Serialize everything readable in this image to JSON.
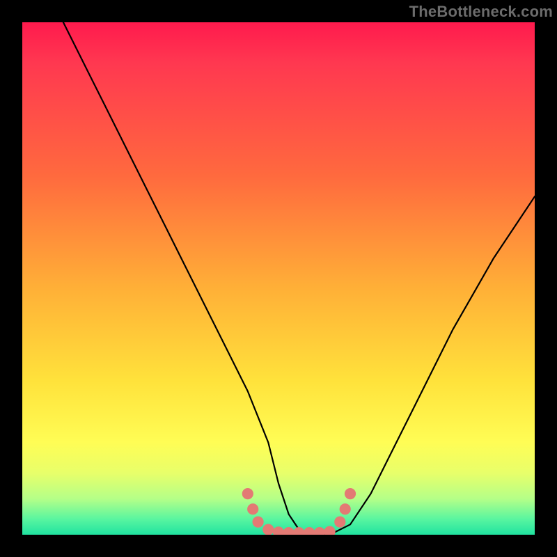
{
  "watermark": {
    "text": "TheBottleneck.com"
  },
  "chart_data": {
    "type": "line",
    "title": "",
    "xlabel": "",
    "ylabel": "",
    "xlim": [
      0,
      100
    ],
    "ylim": [
      0,
      100
    ],
    "grid": false,
    "legend": false,
    "background": {
      "kind": "vertical-gradient",
      "stops": [
        {
          "pos": 0,
          "color": "#ff1a4d"
        },
        {
          "pos": 50,
          "color": "#ffb037"
        },
        {
          "pos": 82,
          "color": "#fffd55"
        },
        {
          "pos": 100,
          "color": "#20e3a0"
        }
      ]
    },
    "series": [
      {
        "name": "bottleneck-curve",
        "color": "#000000",
        "x": [
          8,
          12,
          16,
          20,
          24,
          28,
          32,
          36,
          40,
          44,
          48,
          50,
          52,
          54,
          56,
          58,
          60,
          64,
          68,
          72,
          76,
          80,
          84,
          88,
          92,
          96,
          100
        ],
        "y": [
          100,
          92,
          84,
          76,
          68,
          60,
          52,
          44,
          36,
          28,
          18,
          10,
          4,
          1,
          0,
          0,
          0,
          2,
          8,
          16,
          24,
          32,
          40,
          47,
          54,
          60,
          66
        ]
      }
    ],
    "markers": [
      {
        "name": "floor-point",
        "x": 44,
        "y": 8,
        "color": "#e37a74",
        "r": 1.1
      },
      {
        "name": "floor-point",
        "x": 45,
        "y": 5,
        "color": "#e37a74",
        "r": 1.1
      },
      {
        "name": "floor-point",
        "x": 46,
        "y": 2.5,
        "color": "#e37a74",
        "r": 1.1
      },
      {
        "name": "floor-point",
        "x": 48,
        "y": 1.0,
        "color": "#e37a74",
        "r": 1.1
      },
      {
        "name": "floor-point",
        "x": 50,
        "y": 0.5,
        "color": "#e37a74",
        "r": 1.1
      },
      {
        "name": "floor-point",
        "x": 52,
        "y": 0.4,
        "color": "#e37a74",
        "r": 1.1
      },
      {
        "name": "floor-point",
        "x": 54,
        "y": 0.4,
        "color": "#e37a74",
        "r": 1.1
      },
      {
        "name": "floor-point",
        "x": 56,
        "y": 0.4,
        "color": "#e37a74",
        "r": 1.1
      },
      {
        "name": "floor-point",
        "x": 58,
        "y": 0.4,
        "color": "#e37a74",
        "r": 1.1
      },
      {
        "name": "floor-point",
        "x": 60,
        "y": 0.6,
        "color": "#e37a74",
        "r": 1.1
      },
      {
        "name": "floor-point",
        "x": 62,
        "y": 2.5,
        "color": "#e37a74",
        "r": 1.1
      },
      {
        "name": "floor-point",
        "x": 63,
        "y": 5,
        "color": "#e37a74",
        "r": 1.1
      },
      {
        "name": "floor-point",
        "x": 64,
        "y": 8,
        "color": "#e37a74",
        "r": 1.1
      }
    ]
  }
}
